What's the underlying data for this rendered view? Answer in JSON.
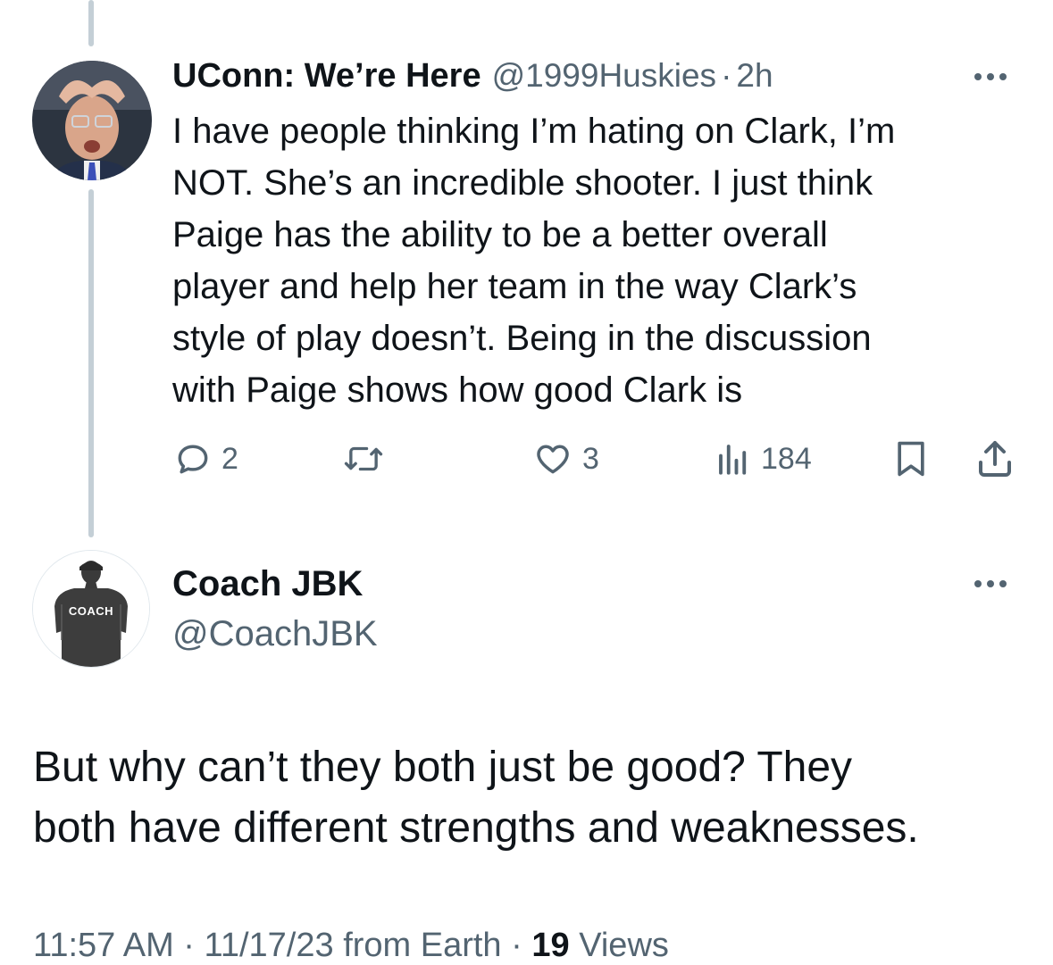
{
  "tweet": {
    "display_name": "UConn: We’re Here",
    "handle": "@1999Huskies",
    "separator": "·",
    "time": "2h",
    "text_lines": [
      "I have people thinking I’m hating on Clark, I’m",
      "NOT. She’s an incredible shooter. I just think",
      "Paige has the ability to be a better overall",
      "player and help her team in the way Clark’s",
      "style of play doesn’t. Being in the discussion",
      "with Paige shows how good Clark is"
    ],
    "replies_count": "2",
    "likes_count": "3",
    "views_count": "184",
    "icons": [
      "reply-icon",
      "retweet-icon",
      "like-icon",
      "views-icon",
      "bookmark-icon",
      "share-icon",
      "more-icon"
    ]
  },
  "reply": {
    "display_name": "Coach JBK",
    "handle": "@CoachJBK",
    "avatar_shirt_text": "COACH",
    "text_lines": [
      "But why can’t they both just be good?  They",
      "both have different strengths and weaknesses."
    ],
    "meta": {
      "time": "11:57 AM",
      "separator": "·",
      "date": "11/17/23",
      "source": "from Earth",
      "views_count": "19",
      "views_label": "Views"
    }
  },
  "colors": {
    "text": "#0f1419",
    "muted": "#536471",
    "thread_line": "#c4cfd6"
  }
}
